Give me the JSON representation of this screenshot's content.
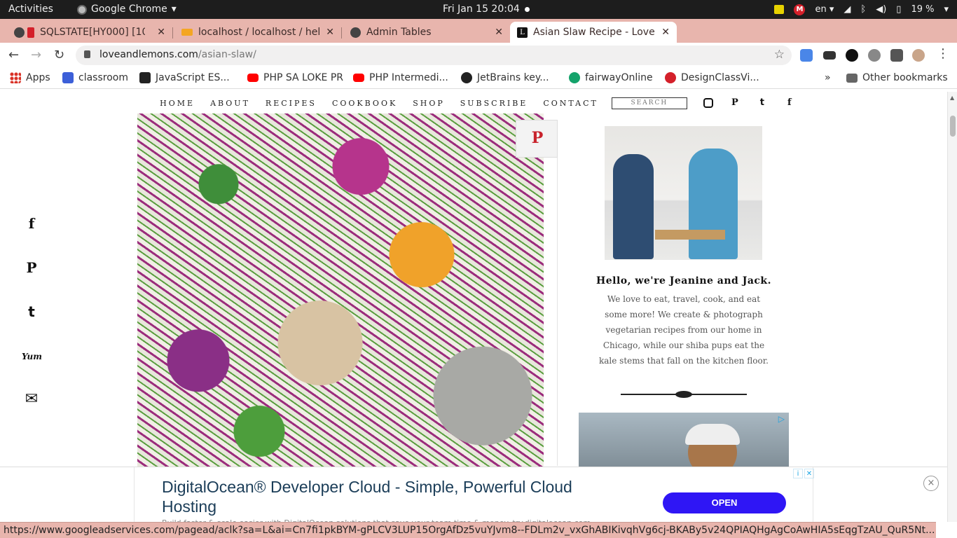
{
  "system": {
    "activities": "Activities",
    "app_menu": "Google Chrome",
    "clock": "Fri Jan 15  20:04",
    "tray_badge": "M",
    "language": "en",
    "battery": "19 %"
  },
  "tabs": [
    {
      "title": "SQLSTATE[HY000] [10",
      "icon": "error-favicon"
    },
    {
      "title": "localhost / localhost / hel",
      "icon": "phpmyadmin-favicon"
    },
    {
      "title": "Admin Tables",
      "icon": "globe-favicon"
    },
    {
      "title": "Asian Slaw Recipe - Love a",
      "icon": "loveandlemons-favicon"
    }
  ],
  "address": {
    "domain": "loveandlemons.com",
    "path": "/asian-slaw/"
  },
  "bookmarks": [
    {
      "label": "Apps",
      "color": "#d93025"
    },
    {
      "label": "classroom",
      "color": "#3c5fd8"
    },
    {
      "label": "JavaScript ES...",
      "color": "#222222"
    },
    {
      "label": "PHP SA LOKE PR",
      "color": "#ff0000"
    },
    {
      "label": "PHP Intermedi...",
      "color": "#ff0000"
    },
    {
      "label": "JetBrains key...",
      "color": "#222222"
    },
    {
      "label": "fairwayOnline",
      "color": "#14a36b"
    },
    {
      "label": "DesignClassVi...",
      "color": "#d4202a"
    }
  ],
  "bookmarks_overflow": "»",
  "other_bookmarks": "Other bookmarks",
  "site_nav": [
    "HOME",
    "ABOUT",
    "RECIPES",
    "COOKBOOK",
    "SHOP",
    "SUBSCRIBE",
    "CONTACT"
  ],
  "search_placeholder": "SEARCH",
  "social_header": [
    "instagram-icon",
    "pinterest-icon",
    "twitter-icon",
    "facebook-icon"
  ],
  "share_bar": [
    {
      "icon": "facebook-icon",
      "glyph": "f"
    },
    {
      "icon": "pinterest-icon",
      "glyph": "P"
    },
    {
      "icon": "twitter-icon",
      "glyph": "t"
    },
    {
      "icon": "yummly-icon",
      "glyph": "Yum"
    },
    {
      "icon": "email-icon",
      "glyph": "✉"
    }
  ],
  "pin_glyph": "P",
  "about": {
    "heading": "Hello, we're Jeanine and Jack.",
    "body": "We love to eat, travel, cook, and eat some more! We create & photograph vegetarian recipes from our home in Chicago, while our shiba pups eat the kale stems that fall on the kitchen floor."
  },
  "bottom_ad": {
    "title": "DigitalOcean® Developer Cloud - Simple, Powerful Cloud Hosting",
    "subtitle": "Build faster & scale easier with DigitalOcean solutions that save your team time & money. try.digitalocean.com",
    "button": "OPEN",
    "close": "×"
  },
  "status_url": "https://www.googleadservices.com/pagead/aclk?sa=L&ai=Cn7fi1pkBYM-gPLCV3LUP15OrgAfDz5vuYJvm8--FDLm2v_vxGhABIKivqhVg6cj-BKABy5v24QPIAQHgAgCoAwHIA5sEqgTzAU_QuR5Nt..."
}
